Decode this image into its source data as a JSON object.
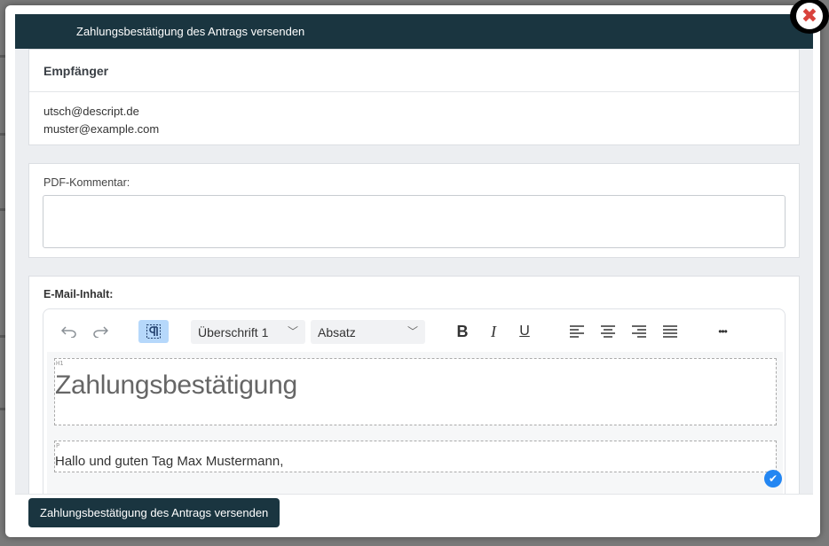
{
  "modal": {
    "title": "Zahlungsbestätigung des Antrags versenden",
    "close_icon": "close-icon"
  },
  "recipients": {
    "heading": "Empfänger",
    "emails": [
      "utsch@descript.de",
      "muster@example.com"
    ]
  },
  "pdf_comment": {
    "label": "PDF-Kommentar:",
    "value": ""
  },
  "email_content": {
    "label": "E-Mail-Inhalt:",
    "toolbar": {
      "undo_icon": "undo-icon",
      "redo_icon": "redo-icon",
      "paragraph_marks_icon": "pilcrow-icon",
      "heading_select": "Überschrift 1",
      "block_select": "Absatz",
      "bold": "B",
      "italic": "I",
      "underline": "U",
      "align_left_icon": "align-left-icon",
      "align_center_icon": "align-center-icon",
      "align_right_icon": "align-right-icon",
      "justify_icon": "align-justify-icon",
      "more": "•••"
    },
    "blocks": [
      {
        "tag": "H1",
        "text": "Zahlungsbestätigung"
      },
      {
        "tag": "P",
        "text": "Hallo und guten Tag Max Mustermann,"
      }
    ],
    "accent_color": "#2386f2"
  },
  "footer": {
    "send_label": "Zahlungsbestätigung des Antrags versenden"
  },
  "colors": {
    "header_bg": "#1a3540",
    "button_bg": "#1a3540",
    "close_red": "#d9423c"
  }
}
